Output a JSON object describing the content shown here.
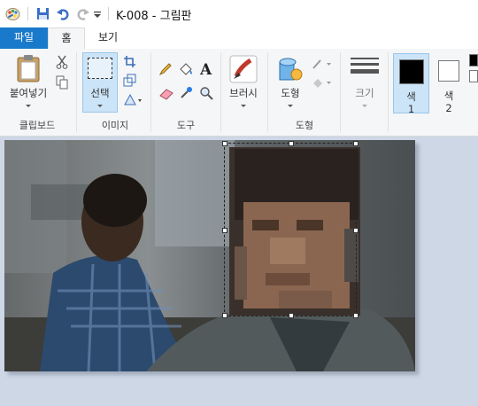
{
  "window": {
    "title": "K-008 - 그림판"
  },
  "tabs": {
    "file": "파일",
    "home": "홈",
    "view": "보기"
  },
  "ribbon": {
    "clipboard": {
      "paste": "붙여넣기",
      "group": "클립보드"
    },
    "image": {
      "select": "선택",
      "group": "이미지"
    },
    "tools": {
      "group": "도구"
    },
    "brushes": {
      "label": "브러시"
    },
    "shapes": {
      "label": "도형",
      "group": "도형"
    },
    "size": {
      "label": "크기"
    },
    "color1": {
      "label": "색\n1",
      "line1": "색",
      "line2": "1",
      "value": "#000000"
    },
    "color2": {
      "line1": "색",
      "line2": "2",
      "value": "#ffffff"
    }
  },
  "colors": {
    "accent": "#1979ca",
    "selected_bg": "#cce4f7",
    "workspace": "#cdd7e5"
  },
  "canvas": {
    "content": "photo with pixelated face region (selected)"
  }
}
